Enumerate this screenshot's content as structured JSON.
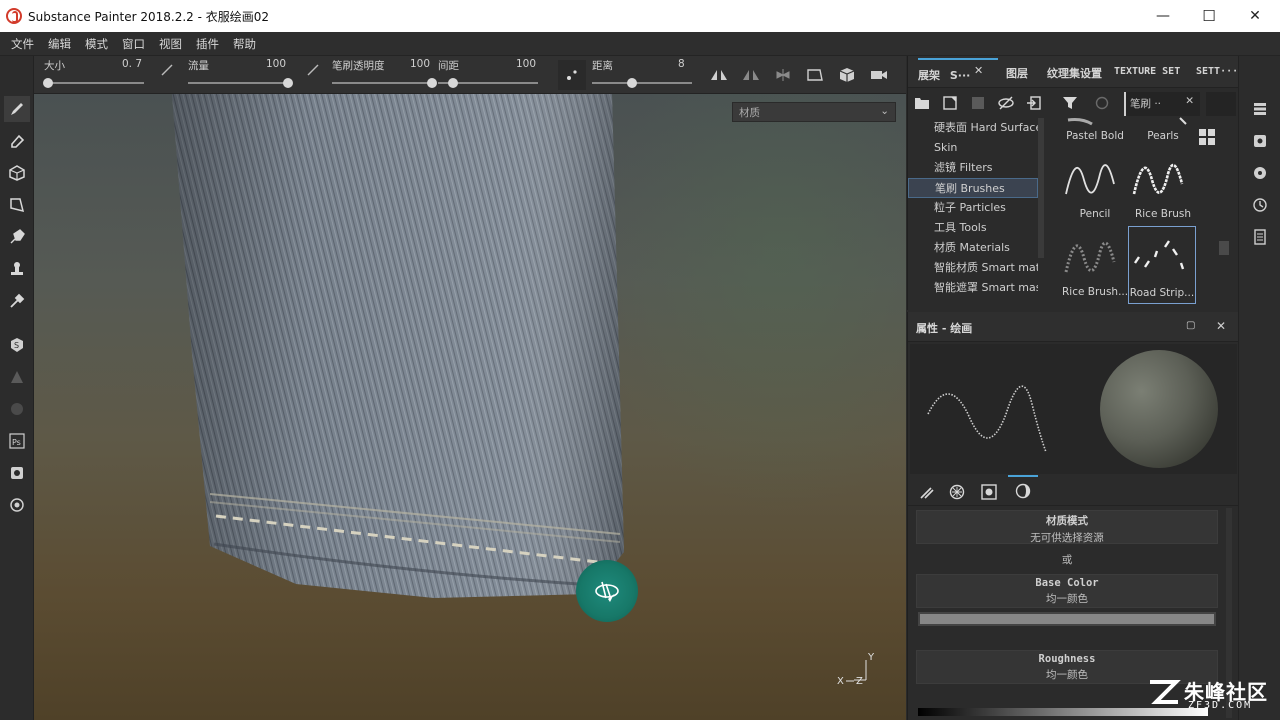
{
  "window": {
    "title": "Substance Painter 2018.2.2 - 衣服绘画02",
    "minimize": "—",
    "maximize": "☐",
    "close": "✕"
  },
  "menu": [
    "文件",
    "编辑",
    "模式",
    "窗口",
    "视图",
    "插件",
    "帮助"
  ],
  "toolbar": {
    "size": {
      "label": "大小",
      "value": "0. 7",
      "level": 0.04
    },
    "flow": {
      "label": "流量",
      "value": "100",
      "level": 1.0
    },
    "opacity": {
      "label": "笔刷透明度",
      "value": "100",
      "level": 1.0
    },
    "spacing": {
      "label": "间距",
      "value": "100",
      "level": 0.15
    },
    "distance": {
      "label": "距离",
      "value": "8",
      "level": 0.4
    }
  },
  "viewport": {
    "mode_dropdown": "材质",
    "axis_y": "Y",
    "axis_x": "X",
    "axis_z": "Z"
  },
  "shelf": {
    "tabs": [
      "展架",
      "S···",
      "图层",
      "纹理集设置",
      "TEXTURE SET",
      "SETT···"
    ],
    "filter_label": "笔刷 ··",
    "categories": [
      {
        "label": "硬表面 Hard Surface",
        "selected": false
      },
      {
        "label": "Skin",
        "selected": false
      },
      {
        "label": "滤镜 Filters",
        "selected": false
      },
      {
        "label": "笔刷 Brushes",
        "selected": true
      },
      {
        "label": "粒子 Particles",
        "selected": false
      },
      {
        "label": "工具 Tools",
        "selected": false
      },
      {
        "label": "材质 Materials",
        "selected": false
      },
      {
        "label": "智能材质 Smart mate",
        "selected": false
      },
      {
        "label": "智能遮罩 Smart mas",
        "selected": false
      }
    ],
    "thumbnails": [
      {
        "label": "Pastel Bold",
        "selected": false
      },
      {
        "label": "Pearls",
        "selected": false
      },
      {
        "label": "Pencil",
        "selected": false
      },
      {
        "label": "Rice Brush",
        "selected": false
      },
      {
        "label": "Rice Brush...",
        "selected": false
      },
      {
        "label": "Road Strip...",
        "selected": true
      }
    ]
  },
  "properties": {
    "title": "属性 - 绘画",
    "material_mode": {
      "title": "材质模式",
      "sub": "无可供选择资源"
    },
    "or": "或",
    "base_color": {
      "title": "Base Color",
      "sub": "均一颜色"
    },
    "roughness": {
      "title": "Roughness",
      "sub": "均一颜色"
    }
  },
  "watermark": {
    "text": "朱峰社区",
    "url": "ZF3D.COM"
  },
  "colors": {
    "accent": "#4aa3d8",
    "cursor": "#1a8274",
    "logo": "#d23b2b"
  }
}
